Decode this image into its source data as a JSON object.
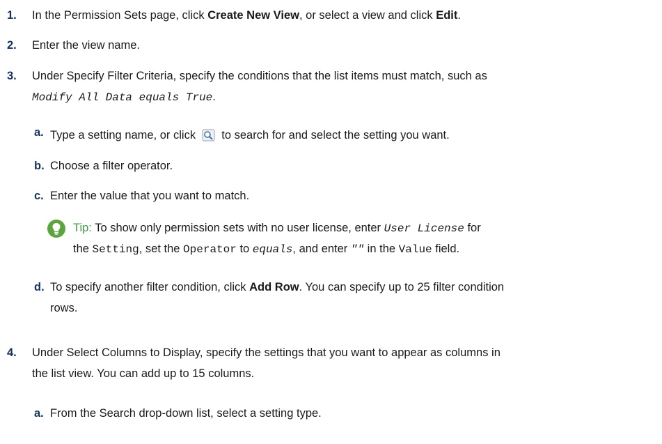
{
  "steps": [
    {
      "num": "1.",
      "pre": "In the Permission Sets page, click ",
      "bold1": "Create New View",
      "mid": ", or select a view and click ",
      "bold2": "Edit",
      "post": "."
    },
    {
      "num": "2.",
      "text": "Enter the view name."
    },
    {
      "num": "3.",
      "line1": "Under Specify Filter Criteria, specify the conditions that the list items must match, such as",
      "line2_code": "Modify All Data equals True",
      "line2_post": "."
    },
    {
      "num": "4.",
      "line1": "Under Select Columns to Display, specify the settings that you want to appear as columns in",
      "line2": "the list view. You can add up to 15 columns."
    }
  ],
  "substeps3": [
    {
      "num": "a.",
      "pre": "Type a setting name, or click ",
      "icon": "search-lookup-icon",
      "post": " to search for and select the setting you want."
    },
    {
      "num": "b.",
      "text": "Choose a filter operator."
    },
    {
      "num": "c.",
      "text": "Enter the value that you want to match."
    },
    {
      "num": "d.",
      "pre": "To specify another filter condition, click ",
      "bold": "Add Row",
      "post": ". You can specify up to 25 filter condition",
      "line2": "rows."
    }
  ],
  "tip": {
    "icon": "lightbulb-icon",
    "label": "Tip:",
    "l1_pre": " To show only permission sets with no user license, enter ",
    "l1_code": "User License",
    "l1_post": " for",
    "l2_a": "the ",
    "l2_code1": "Setting",
    "l2_b": ", set the ",
    "l2_code2": "Operator",
    "l2_c": " to ",
    "l2_code3": "equals",
    "l2_d": ", and enter ",
    "l2_code4": "\"\"",
    "l2_e": " in the ",
    "l2_code5": "Value",
    "l2_f": " field."
  },
  "substeps4": [
    {
      "num": "a.",
      "text": "From the Search drop-down list, select a setting type."
    }
  ],
  "colors": {
    "number": "#16325c",
    "tip_label": "#3f9b3f",
    "tip_icon": "#5ca43f"
  }
}
